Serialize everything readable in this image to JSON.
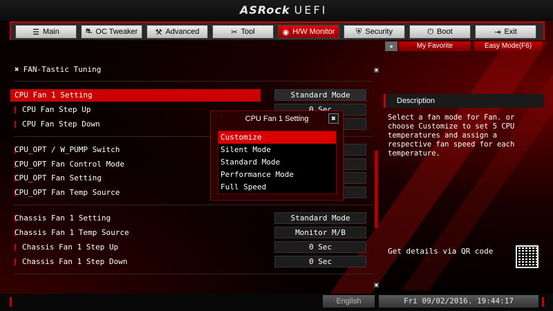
{
  "brand": {
    "logo_main": "ASRock",
    "logo_sub": "UEFI"
  },
  "tabs": [
    {
      "icon": "☰",
      "label": "Main"
    },
    {
      "icon": "⛐",
      "label": "OC Tweaker"
    },
    {
      "icon": "⚒",
      "label": "Advanced"
    },
    {
      "icon": "✂",
      "label": "Tool"
    },
    {
      "icon": "◉",
      "label": "H/W Monitor"
    },
    {
      "icon": "⛨",
      "label": "Security"
    },
    {
      "icon": "⏻",
      "label": "Boot"
    },
    {
      "icon": "⇥",
      "label": "Exit"
    }
  ],
  "favorite": {
    "star": "★",
    "label": "My Favorite"
  },
  "easy_mode": "Easy Mode(F6)",
  "section": {
    "icon": "✖",
    "title": "FAN-Tastic Tuning"
  },
  "settings": [
    {
      "label": "CPU Fan 1 Setting",
      "value": "Standard Mode"
    },
    {
      "label": "CPU Fan Step Up",
      "value": "0 Sec"
    },
    {
      "label": "CPU Fan Step Down",
      "value": "0 Sec"
    },
    {
      "label": "CPU_OPT / W_PUMP Switch",
      "value": ""
    },
    {
      "label": "CPU_OPT Fan Control Mode",
      "value": ""
    },
    {
      "label": "CPU_OPT Fan Setting",
      "value": ""
    },
    {
      "label": "CPU_OPT Fan Temp Source",
      "value": ""
    },
    {
      "label": "Chassis Fan 1 Setting",
      "value": "Standard Mode"
    },
    {
      "label": "Chassis Fan 1 Temp Source",
      "value": "Monitor M/B"
    },
    {
      "label": "Chassis Fan 1 Step Up",
      "value": "0 Sec"
    },
    {
      "label": "Chassis Fan 1 Step Down",
      "value": "0 Sec"
    }
  ],
  "description": {
    "title": "Description",
    "text": "Select a fan mode for Fan. or choose Customize to set 5 CPU temperatures and assign a respective fan speed for each temperature.",
    "qr_label": "Get details via QR code"
  },
  "popup": {
    "title": "CPU Fan 1 Setting",
    "close": "✖",
    "options": [
      "Customize",
      "Silent Mode",
      "Standard Mode",
      "Performance Mode",
      "Full Speed"
    ],
    "selected": "Customize"
  },
  "footer": {
    "language": "English",
    "datetime": "Fri 09/02/2016. 19:44:17"
  },
  "colors": {
    "accent": "#cc0000",
    "background": "#000000",
    "text": "#ffffff"
  }
}
